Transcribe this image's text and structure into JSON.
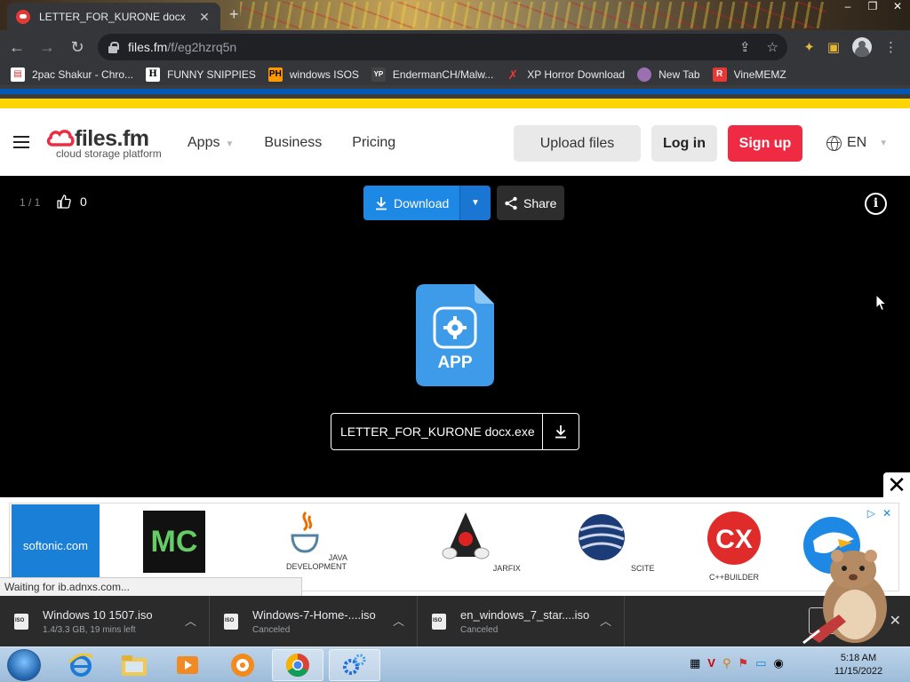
{
  "browser": {
    "tab_title": "LETTER_FOR_KURONE docx",
    "url_host": "files.fm",
    "url_path": "/f/eg2hzrq5n",
    "bookmarks": [
      {
        "label": "2pac Shakur - Chro...",
        "icon": "bookmark-page-icon",
        "color": "#e24b4b"
      },
      {
        "label": "FUNNY SNIPPIES",
        "icon": "h-icon",
        "color": "#ffffff"
      },
      {
        "label": "windows ISOS",
        "icon": "ph-icon",
        "color": "#ff9900"
      },
      {
        "label": "EndermanCH/Malw...",
        "icon": "yp-icon",
        "color": "#444444"
      },
      {
        "label": "XP Horror Download",
        "icon": "x-icon",
        "color": "#e53935"
      },
      {
        "label": "New Tab",
        "icon": "globe-icon",
        "color": "#9c6fb0"
      },
      {
        "label": "VineMEMZ",
        "icon": "r-icon",
        "color": "#e53935"
      }
    ]
  },
  "site": {
    "logo_name": "files.fm",
    "logo_tagline": "cloud storage platform",
    "nav": {
      "apps": "Apps",
      "business": "Business",
      "pricing": "Pricing"
    },
    "upload_label": "Upload files",
    "login_label": "Log in",
    "signup_label": "Sign up",
    "language": "EN",
    "brand_color": "#ef2b44"
  },
  "viewer": {
    "counter": "1 / 1",
    "likes": "0",
    "download_label": "Download",
    "share_label": "Share",
    "file_type": "APP",
    "file_name": "LETTER_FOR_KURONE docx.exe",
    "accent": "#1e88e5"
  },
  "ad": {
    "softonic": "softonic.com",
    "items": [
      "JAVA DEVELOPMENT",
      "JARFIX",
      "SCITE",
      "C++BUILDER"
    ]
  },
  "status_text": "Waiting for ib.adnxs.com...",
  "downloads": [
    {
      "name": "Windows 10 1507.iso",
      "status": "1.4/3.3 GB, 19 mins left"
    },
    {
      "name": "Windows-7-Home-....iso",
      "status": "Canceled"
    },
    {
      "name": "en_windows_7_star....iso",
      "status": "Canceled"
    }
  ],
  "taskbar": {
    "time": "5:18 AM",
    "date": "11/15/2022"
  }
}
